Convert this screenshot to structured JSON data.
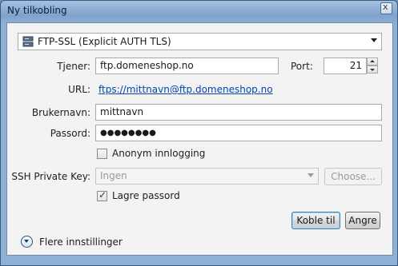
{
  "window": {
    "title": "Ny tilkobling",
    "close_glyph": "x"
  },
  "protocol": {
    "selected": "FTP-SSL (Explicit AUTH TLS)",
    "icon": "server-icon"
  },
  "server": {
    "label": "Tjener:",
    "value": "ftp.domeneshop.no"
  },
  "port": {
    "label": "Port:",
    "value": "21"
  },
  "url": {
    "label": "URL:",
    "value": "ftps://mittnavn@ftp.domeneshop.no"
  },
  "username": {
    "label": "Brukernavn:",
    "value": "mittnavn"
  },
  "password": {
    "label": "Passord:",
    "value": "●●●●●●●●"
  },
  "anonymous": {
    "label": "Anonym innlogging",
    "checked": false
  },
  "ssh_key": {
    "label": "SSH Private Key:",
    "selected": "Ingen",
    "choose_label": "Choose..."
  },
  "save_password": {
    "label": "Lagre passord",
    "checked": true,
    "glyph": "✓"
  },
  "actions": {
    "connect_label": "Koble til",
    "cancel_label": "Angre"
  },
  "more_settings": {
    "label": "Flere innstillinger"
  }
}
